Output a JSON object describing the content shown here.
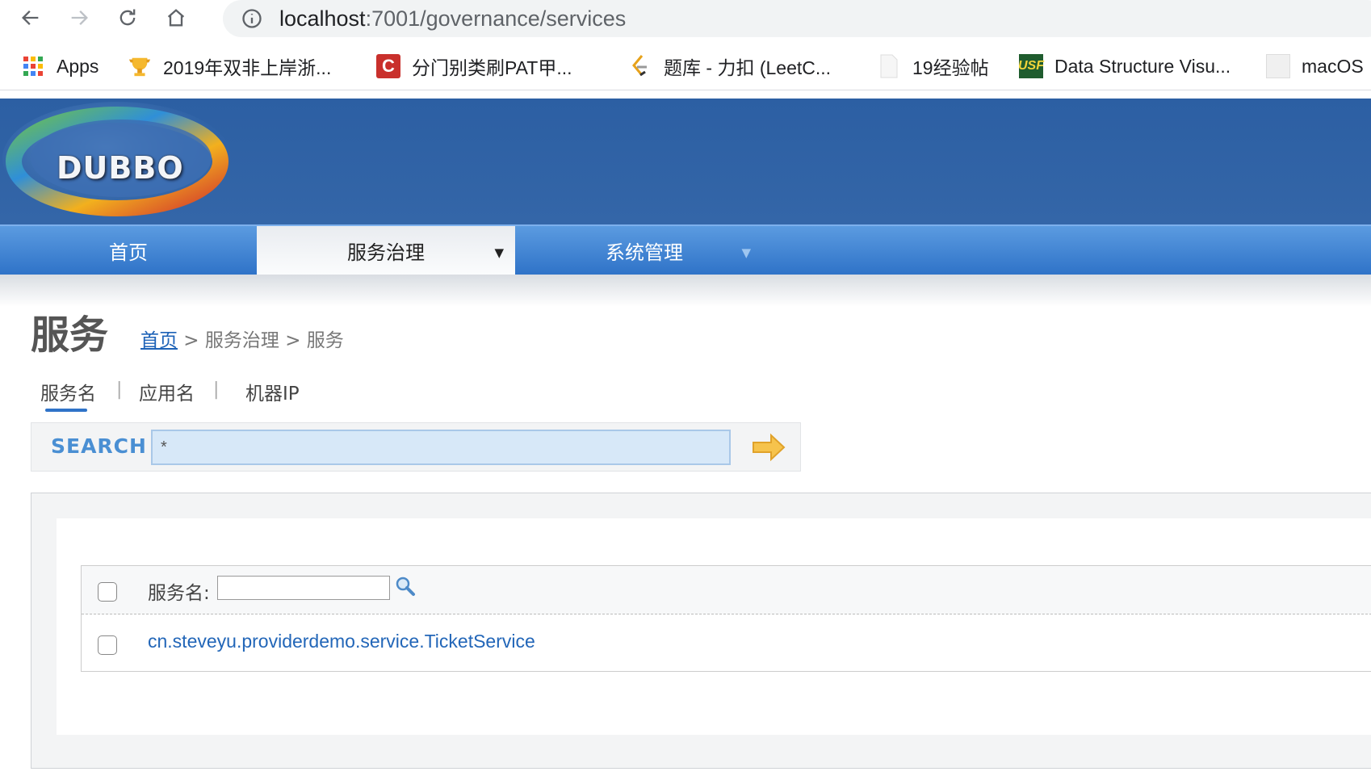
{
  "browser": {
    "url_host": "localhost",
    "url_path": ":7001/governance/services",
    "bookmarks": [
      {
        "label": "Apps",
        "icon": "apps-grid-icon"
      },
      {
        "label": "2019年双非上岸浙...",
        "icon": "trophy-icon"
      },
      {
        "label": "分门别类刷PAT甲...",
        "icon": "csdn-icon"
      },
      {
        "label": "题库 - 力扣 (LeetC...",
        "icon": "leetcode-icon"
      },
      {
        "label": "19经验帖",
        "icon": "page-icon"
      },
      {
        "label": "Data Structure Visu...",
        "icon": "usf-icon"
      },
      {
        "label": "macOS",
        "icon": "macos-icon"
      }
    ]
  },
  "header": {
    "logo_text": "DUBBO"
  },
  "menu": {
    "items": [
      {
        "label": "首页"
      },
      {
        "label": "服务治理",
        "caret": "▼"
      },
      {
        "label": "系统管理",
        "caret": "▼"
      }
    ]
  },
  "page": {
    "title": "服务",
    "breadcrumb_home": "首页",
    "breadcrumb_rest": " > 服务治理 > 服务"
  },
  "search": {
    "tabs": [
      "服务名",
      "应用名",
      "机器IP"
    ],
    "separator": "|",
    "label": "SEARCH",
    "value": "*"
  },
  "list": {
    "filter_label": "服务名:",
    "rows": [
      {
        "service": "cn.steveyu.providerdemo.service.TicketService"
      }
    ]
  },
  "colors": {
    "header_blue": "#3466a8",
    "menu_blue": "#2f73c8",
    "link_blue": "#2266b8"
  }
}
